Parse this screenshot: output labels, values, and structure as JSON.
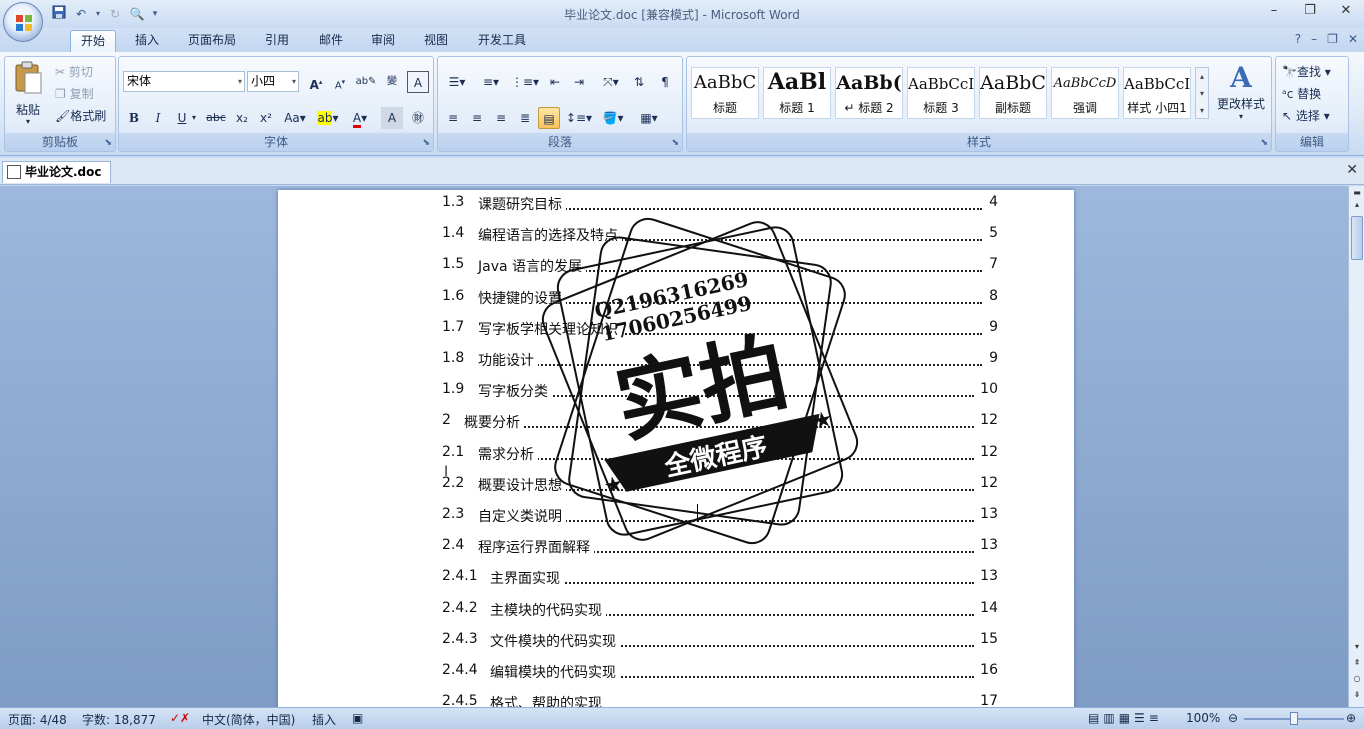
{
  "window": {
    "title": "毕业论文.doc [兼容模式] - Microsoft Word",
    "min": "–",
    "max": "❐",
    "close": "✕"
  },
  "tabs": [
    "开始",
    "插入",
    "页面布局",
    "引用",
    "邮件",
    "审阅",
    "视图",
    "开发工具"
  ],
  "tab_right": [
    "?",
    "–",
    "❐",
    "✕"
  ],
  "clipboard": {
    "paste": "粘贴",
    "cut": "剪切",
    "copy": "复制",
    "format_painter": "格式刷",
    "label": "剪贴板"
  },
  "font": {
    "name": "宋体",
    "size": "小四",
    "label": "字体",
    "bold": "B",
    "italic": "I",
    "underline": "U",
    "strike": "abc",
    "subscript": "x₂",
    "superscript": "x²",
    "case": "Aa",
    "grow": "A",
    "shrink": "A",
    "clear": "A",
    "highlight": "ab",
    "color": "A"
  },
  "paragraph": {
    "label": "段落"
  },
  "styles": {
    "label": "样式",
    "items": [
      {
        "sample": "AaBbC",
        "name": "标题"
      },
      {
        "sample": "AaBl",
        "name": "标题 1"
      },
      {
        "sample": "AaBb(",
        "name": "↵ 标题 2"
      },
      {
        "sample": "AaBbCcI",
        "name": "标题 3"
      },
      {
        "sample": "AaBbC",
        "name": "副标题"
      },
      {
        "sample": "AaBbCcD",
        "name": "强调"
      },
      {
        "sample": "AaBbCcI",
        "name": "样式 小四1"
      }
    ],
    "change": "更改样式"
  },
  "editing": {
    "label": "编辑",
    "find": "查找",
    "replace": "替换",
    "select": "选择"
  },
  "document": {
    "tab": "毕业论文.doc",
    "toc": [
      {
        "num": "1.3",
        "title": "课题研究目标",
        "page": "4"
      },
      {
        "num": "1.4",
        "title": "编程语言的选择及特点",
        "page": "5"
      },
      {
        "num": "1.5",
        "title": "Java 语言的发展",
        "page": "7"
      },
      {
        "num": "1.6",
        "title": "快捷键的设置",
        "page": "8"
      },
      {
        "num": "1.7",
        "title": "写字板学相关理论知识",
        "page": "9"
      },
      {
        "num": "1.8",
        "title": "功能设计",
        "page": "9"
      },
      {
        "num": "1.9",
        "title": "写字板分类",
        "page": "10"
      },
      {
        "num": "2",
        "title": "概要分析",
        "page": "12"
      },
      {
        "num": "2.1",
        "title": "需求分析",
        "page": "12"
      },
      {
        "num": "2.2",
        "title": "概要设计思想",
        "page": "12"
      },
      {
        "num": "2.3",
        "title": "自定义类说明",
        "page": "13"
      },
      {
        "num": "2.4",
        "title": "程序运行界面解释",
        "page": "13"
      },
      {
        "num": "2.4.1",
        "title": "主界面实现",
        "page": "13"
      },
      {
        "num": "2.4.2",
        "title": "主模块的代码实现",
        "page": "14"
      },
      {
        "num": "2.4.3",
        "title": "文件模块的代码实现",
        "page": "15"
      },
      {
        "num": "2.4.4",
        "title": "编辑模块的代码实现",
        "page": "16"
      },
      {
        "num": "2.4.5",
        "title": "格式、帮助的实现",
        "page": "17"
      }
    ]
  },
  "stamp": {
    "line1": "Q2196316269",
    "line2": "17060256499",
    "main": "实拍",
    "banner": "全微程序"
  },
  "status": {
    "page": "页面: 4/48",
    "words": "字数: 18,877",
    "language": "中文(简体，中国)",
    "mode": "插入",
    "zoom": "100%"
  }
}
